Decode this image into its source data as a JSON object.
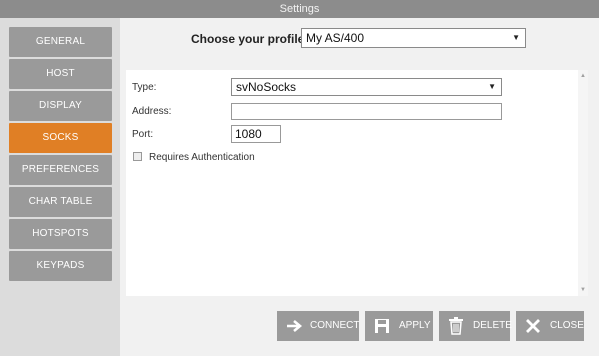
{
  "window": {
    "title": "Settings"
  },
  "sidebar": {
    "items": [
      {
        "label": "GENERAL",
        "active": false
      },
      {
        "label": "HOST",
        "active": false
      },
      {
        "label": "DISPLAY",
        "active": false
      },
      {
        "label": "SOCKS",
        "active": true
      },
      {
        "label": "PREFERENCES",
        "active": false
      },
      {
        "label": "CHAR TABLE",
        "active": false
      },
      {
        "label": "HOTSPOTS",
        "active": false
      },
      {
        "label": "KEYPADS",
        "active": false
      }
    ],
    "inactive_color": "#9a9a9a",
    "active_color": "#e07f25"
  },
  "profile": {
    "label": "Choose your profile:",
    "selected": "My AS/400"
  },
  "socks": {
    "type_label": "Type:",
    "type_value": "svNoSocks",
    "address_label": "Address:",
    "address_value": "",
    "port_label": "Port:",
    "port_value": "1080",
    "auth_label": "Requires Authentication",
    "auth_checked": false
  },
  "buttons": {
    "connect": "CONNECT",
    "apply": "APPLY",
    "delete": "DELETE",
    "close": "CLOSE"
  },
  "icons": {
    "connect": "arrow-right-icon",
    "apply": "floppy-disk-icon",
    "delete": "trash-icon",
    "close": "close-x-icon",
    "select_caret": "caret-down-icon"
  }
}
